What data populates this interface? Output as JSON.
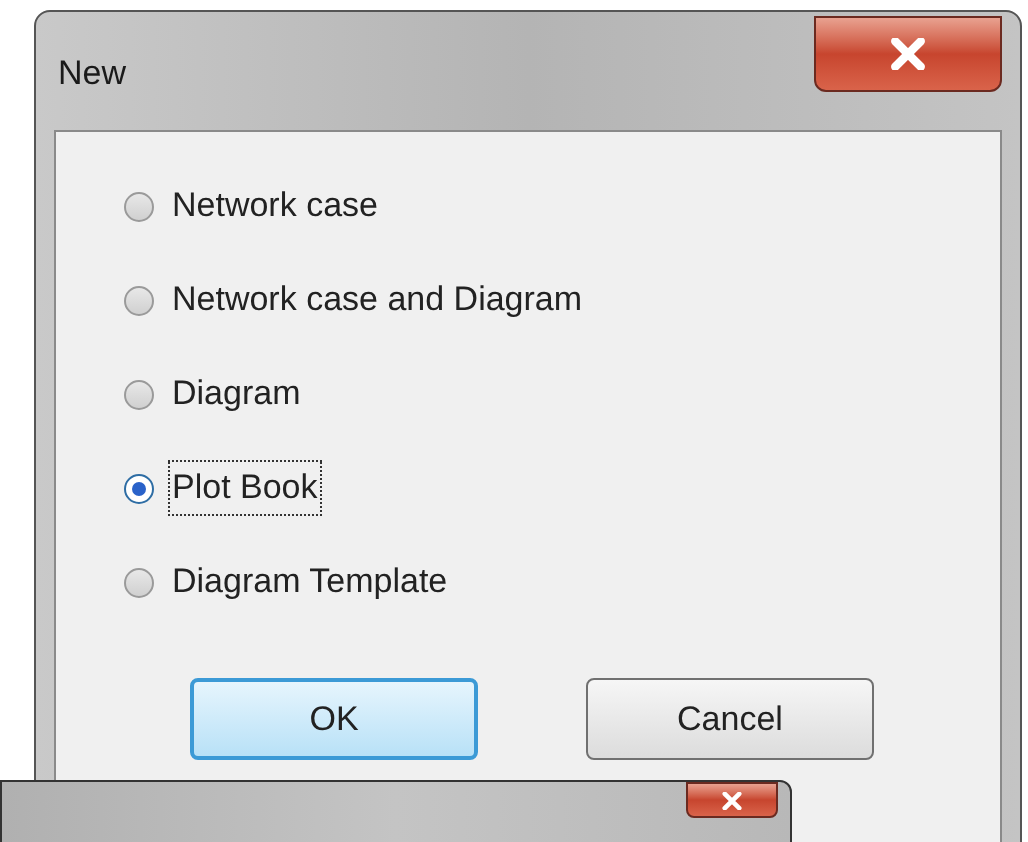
{
  "window": {
    "title": "New"
  },
  "options": [
    {
      "label": "Network case",
      "selected": false,
      "focused": false
    },
    {
      "label": "Network case and Diagram",
      "selected": false,
      "focused": false
    },
    {
      "label": "Diagram",
      "selected": false,
      "focused": false
    },
    {
      "label": "Plot Book",
      "selected": true,
      "focused": true
    },
    {
      "label": "Diagram Template",
      "selected": false,
      "focused": false
    }
  ],
  "buttons": [
    {
      "label": "OK",
      "default": true
    },
    {
      "label": "Cancel",
      "default": false
    }
  ]
}
